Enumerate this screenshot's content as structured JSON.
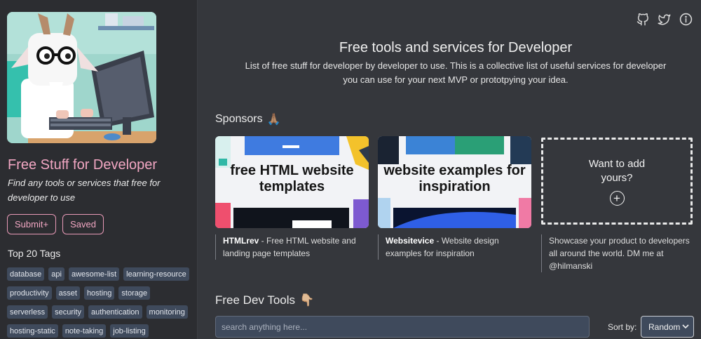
{
  "sidebar": {
    "hero_alt": "pixel art goat coding",
    "title": "Free Stuff for Developer",
    "subtitle": "Find any tools or services that free for developer to use",
    "buttons": {
      "submit": "Submit+",
      "saved": "Saved"
    },
    "tags_heading": "Top 20 Tags",
    "tags": [
      "database",
      "api",
      "awesome-list",
      "learning-resource",
      "productivity",
      "asset",
      "hosting",
      "storage",
      "serverless",
      "security",
      "authentication",
      "monitoring",
      "hosting-static",
      "note-taking",
      "job-listing"
    ]
  },
  "header": {
    "icons": [
      "github-icon",
      "twitter-icon",
      "info-icon"
    ],
    "title": "Free tools and services for Developer",
    "description": "List of free stuff for developer by developer to use. This is a collective list of useful services for developer you can use for your next MVP or prototpying your idea."
  },
  "sponsors": {
    "label": "Sponsors",
    "label_emoji": "🙏🏽",
    "cards": [
      {
        "image_text": "free HTML website templates",
        "name": "HTMLrev",
        "desc": " - Free HTML website and landing page templates"
      },
      {
        "image_text": "website examples for inspiration",
        "name": "Websitevice",
        "desc": " - Website design examples for inspiration"
      }
    ],
    "cta": {
      "text": "Want to add yours?",
      "plus": "+",
      "caption": "Showcase your product to developers all around the world. DM me at @hilmanski"
    }
  },
  "tools": {
    "label": "Free Dev Tools",
    "label_emoji": "👇🏼",
    "search_placeholder": "search anything here...",
    "sort_label": "Sort by:",
    "sort_value": "Random"
  },
  "colors": {
    "accent": "#f2a7c3",
    "tag_bg": "#3f4a5c",
    "page_bg": "#35373c",
    "sidebar_bg": "#2c2d31"
  }
}
